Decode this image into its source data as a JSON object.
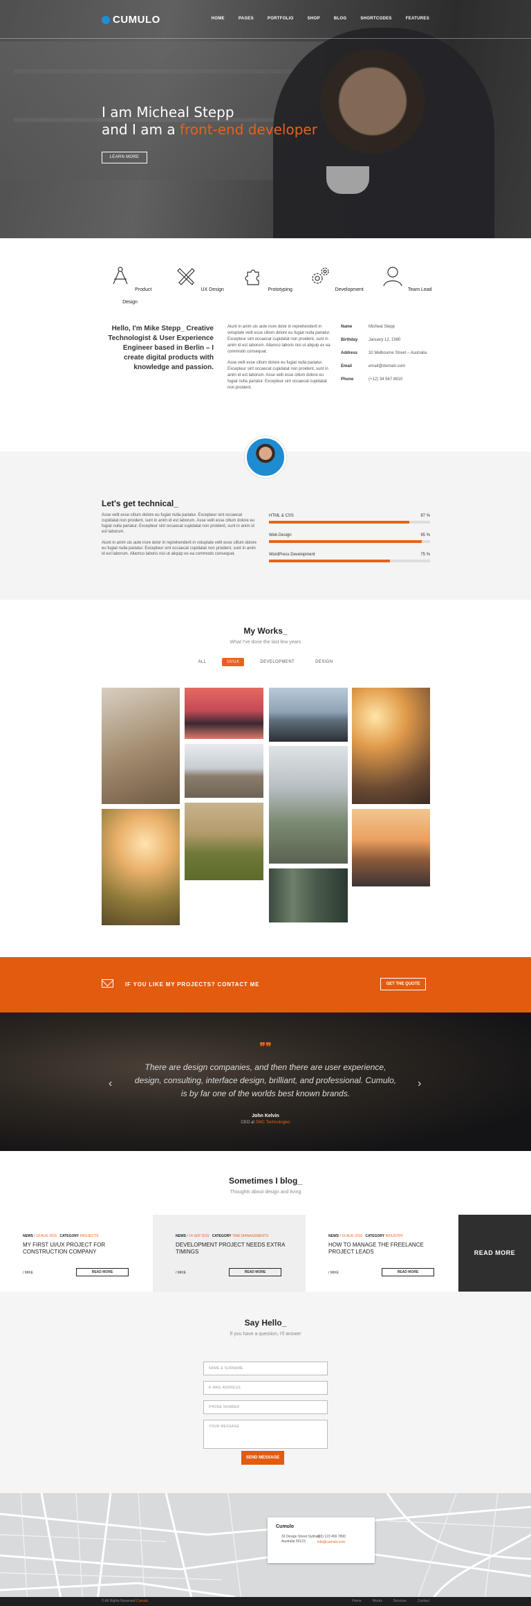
{
  "nav": {
    "logo": "CUMULO",
    "items": [
      "HOME",
      "PAGES",
      "PORTFOLIO",
      "SHOP",
      "BLOG",
      "SHORTCODES",
      "FEATURES"
    ]
  },
  "hero": {
    "line1": "I am Micheal Stepp",
    "line2_prefix": "and I am a ",
    "line2_accent": "front-end developer",
    "button": "LEARN MORE"
  },
  "services": [
    "Product Design",
    "UX Design",
    "Prototyping",
    "Development",
    "Team Lead"
  ],
  "about": {
    "hello": "Hello, I'm Mike Stepp_ Creative Technologist & User Experience Engineer based in Berlin – I create digital products with knowledge and passion.",
    "p1": "Aiunt in anim uis aute irure dolor in reprehenderit in voluptate velit esse cillum dolore eu fugiat nulla pariatur. Excepteur sint occaecat cupidatat non proident, sunt in anim id est laborum. Allamco laboris nisi ut aliquip ex ea commodo consequat.",
    "p2": "Asse velit esse cillum dolore eu fugiat nulla pariatur. Excepteur sint occaecat cupidatat non proident, sunt in anim id est laborum. Asse velit esse cillum dolore eu fugiat nulla pariatur. Excepteur sint occaecat cupidatat non proident.",
    "info": [
      {
        "k": "Name",
        "v": "Micheal Stepp"
      },
      {
        "k": "Birthday",
        "v": "January 12, 1990"
      },
      {
        "k": "Address",
        "v": "32 Melbourne Street – Australia"
      },
      {
        "k": "Email",
        "v": "email@domain.com"
      },
      {
        "k": "Phone",
        "v": "(+12) 34 567 8910"
      }
    ]
  },
  "tech": {
    "title": "Let's get technical_",
    "p1": "Asse velit esse cillum dolore eu fugiat nulla pariatur. Excepteur sint occaecat cupidatat non proident, sunt in anim id est laborum. Asse velit esse cillum dolore eu fugiat nulla pariatur. Excepteur sint occaecat cupidatat non proident, sunt in anim id est laborum.",
    "p2": "Aiunt in anim uis aute irure dolor in reprehenderit in voluptate velit esse cillum dolore eu fugiat nulla pariatur. Excepteur sint occaecat cupidatat non proident, sunt in anim id est laborum. Allamco laboris nisi ut aliquip ex ea commodo consequat.",
    "skills": [
      {
        "name": "HTML & CSS",
        "pct": "87 %",
        "value": 87
      },
      {
        "name": "Web Design",
        "pct": "95 %",
        "value": 95
      },
      {
        "name": "WordPress Development",
        "pct": "75 %",
        "value": 75
      }
    ]
  },
  "works": {
    "title": "My Works_",
    "subtitle": "What I've done the last few years",
    "filters": [
      "ALL",
      "UI/UX",
      "DEVELOPMENT",
      "DESIGN"
    ],
    "active_filter": "UI/UX"
  },
  "cta": {
    "text": "IF YOU LIKE MY PROJECTS? CONTACT ME",
    "button": "GET THE QUOTE"
  },
  "testimonial": {
    "quote": "There are design companies, and then there are user experience, design, consulting, interface design, brilliant, and professional. Cumulo, is by far one of the worlds best known brands.",
    "name": "John Kelvin",
    "role_prefix": "CEO at ",
    "company": "SMC Technologies"
  },
  "blog": {
    "title": "Sometimes I blog_",
    "subtitle": "Thoughts about design and living",
    "posts": [
      {
        "meta_label": "NEWS",
        "date": "18 AUG 2015",
        "cat_label": "CATEGORY",
        "cat": "PROJECTS",
        "title": "MY FIRST UI/UX PROJECT FOR CONSTRUCTION COMPANY",
        "by": "/ MIKE",
        "button": "READ MORE"
      },
      {
        "meta_label": "NEWS",
        "date": "14 SEP 2015",
        "cat_label": "CATEGORY",
        "cat": "TIME MANAGEMENTS",
        "title": "DEVELOPMENT PROJECT NEEDS EXTRA TIMINGS",
        "by": "/ MIKE",
        "button": "READ MORE"
      },
      {
        "meta_label": "NEWS",
        "date": "16 AUG 2015",
        "cat_label": "CATEGORY",
        "cat": "INDUSTRY",
        "title": "HOW TO MANAGE THE FREELANCE PROJECT LEADS",
        "by": "/ MIKE",
        "button": "READ MORE"
      }
    ],
    "readmore_tile": "READ MORE"
  },
  "contact": {
    "title": "Say Hello_",
    "subtitle": "If you have a question, I'll answer",
    "placeholders": [
      "NAME & SURNAME",
      "E-MAIL ADDRESS",
      "PHONE NUMBER",
      "YOUR MESSAGE"
    ],
    "button": "SEND MESSAGE"
  },
  "map_card": {
    "company": "Cumulo",
    "address": "32 Design Street Sydney, Australia 55123",
    "phone": "(00) 123 456 7890",
    "email": "info@cumulo.com"
  },
  "footer": {
    "copy_prefix": "© All Rights Reserved ",
    "copy_brand": "Cumulo",
    "links": [
      "Home",
      "Works",
      "Services",
      "Contact"
    ]
  },
  "colors": {
    "accent": "#e8611a",
    "dark": "#2f2f2f",
    "light_bg": "#f4f4f4"
  }
}
